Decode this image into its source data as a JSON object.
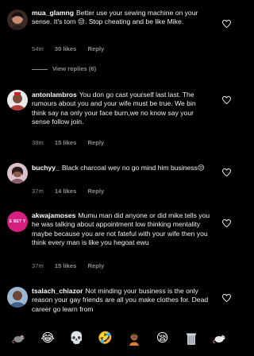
{
  "comments": [
    {
      "username": "mua_glamng",
      "text": "Better use your sewing machine on your sense. It's torn 😒. Stop cheating and be like Mike.",
      "time": "54m",
      "likes": "30 likes",
      "reply": "Reply",
      "avatar_color": "#c98c73"
    },
    {
      "username": "antonlambros",
      "text": "You don go cast yourself last last. The rumours about you and your wife must be true. We bin think say na only your face burn,we no know say your sense follow join.",
      "time": "38m",
      "likes": "15 likes",
      "reply": "Reply",
      "avatar_color": "#b23a3a"
    },
    {
      "username": "buchyy_",
      "text": "Black charcoal wey no go mind him business😒",
      "time": "37m",
      "likes": "14 likes",
      "reply": "Reply",
      "avatar_color": "#8a5a6e"
    },
    {
      "username": "akwajamoses",
      "text": "Mumu man did anyone or did mike tells you he was talking about appointment low thinking mentality maybe because you are not fateful with your wife then you think every man is like you hegoat ewu",
      "time": "37m",
      "likes": "15 likes",
      "reply": "Reply",
      "avatar_color": "#d6207f",
      "avatar_text": "E BET Y"
    },
    {
      "username": "tsalach_chiazor",
      "text": "Not minding your business is the only reason your gay friends are all you make clothes for. Dead career go learn from",
      "avatar_color": "#5b7fa8"
    }
  ],
  "view_replies": "View replies (6)",
  "emoji_bar": [
    "rat",
    "joy",
    "skull",
    "rofl",
    "man-facepalming",
    "sleepy",
    "wastebasket",
    "rat"
  ],
  "emoji_chars": {
    "joy": "😂",
    "skull": "💀",
    "rofl": "🤣",
    "sleepy": "😪"
  },
  "colors": {
    "background": "#000000",
    "text": "#ffffff",
    "muted": "#8e8e8e",
    "heart": "#ffffff"
  }
}
